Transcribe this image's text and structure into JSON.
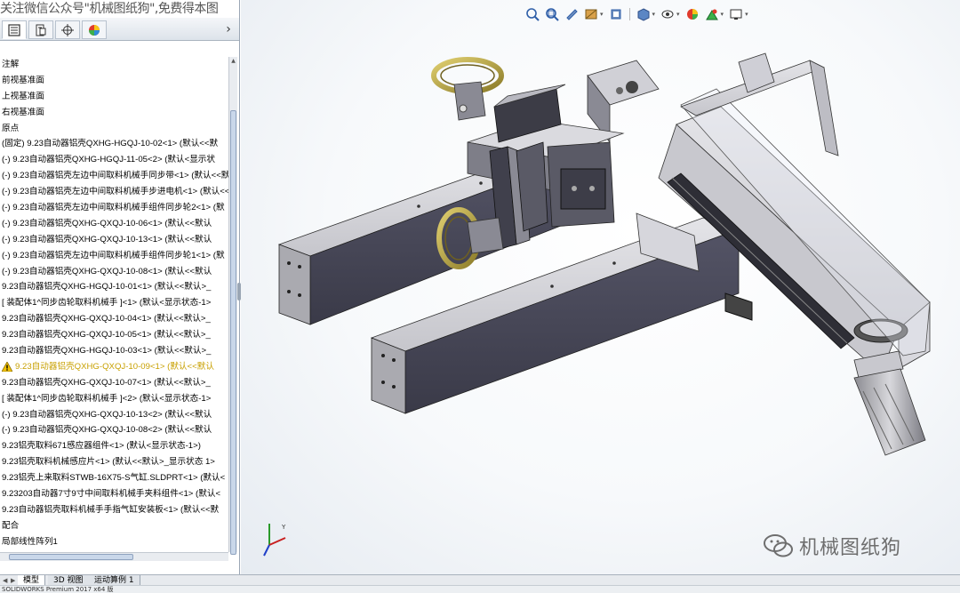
{
  "watermark": {
    "top_text": "关注微信公众号\"机械图纸狗\",免费得本图"
  },
  "feature_manager": {
    "tabs": [
      {
        "icon": "feature-tree-icon"
      },
      {
        "icon": "property-manager-icon"
      },
      {
        "icon": "configuration-manager-icon"
      },
      {
        "icon": "display-manager-icon"
      }
    ],
    "collapse_label": "›",
    "items": [
      {
        "label": "注解"
      },
      {
        "label": "前视基准面"
      },
      {
        "label": "上视基准面"
      },
      {
        "label": "右视基准面"
      },
      {
        "label": "原点"
      },
      {
        "label": "(固定) 9.23自动器铝壳QXHG-HGQJ-10-02<1> (默认<<默"
      },
      {
        "label": "(-) 9.23自动器铝壳QXHG-HGQJ-11-05<2> (默认<显示状"
      },
      {
        "label": "(-) 9.23自动器铝壳左边中间取料机械手同步带<1> (默认<<默"
      },
      {
        "label": "(-) 9.23自动器铝壳左边中间取料机械手步进电机<1> (默认<<"
      },
      {
        "label": "(-) 9.23自动器铝壳左边中间取料机械手组件同步轮2<1> (默"
      },
      {
        "label": "(-) 9.23自动器铝壳QXHG-QXQJ-10-06<1> (默认<<默认"
      },
      {
        "label": "(-) 9.23自动器铝壳QXHG-QXQJ-10-13<1> (默认<<默认"
      },
      {
        "label": "(-) 9.23自动器铝壳左边中间取料机械手组件同步轮1<1> (默"
      },
      {
        "label": "(-) 9.23自动器铝壳QXHG-QXQJ-10-08<1> (默认<<默认"
      },
      {
        "label": "9.23自动器铝壳QXHG-HGQJ-10-01<1> (默认<<默认>_"
      },
      {
        "label": "[ 装配体1^同步齿轮取料机械手 ]<1> (默认<显示状态-1>"
      },
      {
        "label": "9.23自动器铝壳QXHG-QXQJ-10-04<1> (默认<<默认>_"
      },
      {
        "label": "9.23自动器铝壳QXHG-QXQJ-10-05<1> (默认<<默认>_"
      },
      {
        "label": "9.23自动器铝壳QXHG-HGQJ-10-03<1> (默认<<默认>_"
      },
      {
        "label": "9.23自动器铝壳QXHG-QXQJ-10-09<1> (默认<<默认",
        "warning": true
      },
      {
        "label": "9.23自动器铝壳QXHG-QXQJ-10-07<1> (默认<<默认>_"
      },
      {
        "label": "[ 装配体1^同步齿轮取料机械手 ]<2> (默认<显示状态-1>"
      },
      {
        "label": "(-) 9.23自动器铝壳QXHG-QXQJ-10-13<2> (默认<<默认"
      },
      {
        "label": "(-) 9.23自动器铝壳QXHG-QXQJ-10-08<2> (默认<<默认"
      },
      {
        "label": "9.23铝壳取料671感应器组件<1> (默认<显示状态-1>)"
      },
      {
        "label": "9.23铝壳取料机械感应片<1> (默认<<默认>_显示状态 1>"
      },
      {
        "label": "9.23铝壳上来取料STWB-16X75-S气缸.SLDPRT<1> (默认<"
      },
      {
        "label": "9.23203自动器7寸9寸中间取料机械手夹料组件<1> (默认<"
      },
      {
        "label": "9.23自动器铝壳取料机械手手指气缸安装板<1> (默认<<默"
      },
      {
        "label": "配合"
      },
      {
        "label": "局部线性阵列1"
      }
    ]
  },
  "bottom_tabs": [
    {
      "label": "模型"
    },
    {
      "label": "3D 视图"
    },
    {
      "label": "运动算例 1"
    }
  ],
  "status_bar": {
    "text": "SOLIDWORKS Premium 2017 x64 版"
  },
  "heads_up_toolbar": [
    {
      "icon": "zoom-to-fit-icon"
    },
    {
      "icon": "zoom-to-area-icon"
    },
    {
      "icon": "previous-view-icon"
    },
    {
      "icon": "section-view-icon"
    },
    {
      "icon": "view-orientation-icon"
    },
    {
      "icon": "display-style-icon"
    },
    {
      "icon": "hide-show-items-icon"
    },
    {
      "icon": "edit-appearance-icon"
    },
    {
      "icon": "apply-scene-icon"
    },
    {
      "icon": "view-settings-icon"
    }
  ],
  "brand": {
    "text": "机械图纸狗"
  },
  "triad": {
    "y_label": "Y"
  },
  "colors": {
    "warning": "#c8a000",
    "part_gray": "#d4d4d8",
    "part_dark": "#4a4a58",
    "part_gold": "#b8a040"
  }
}
